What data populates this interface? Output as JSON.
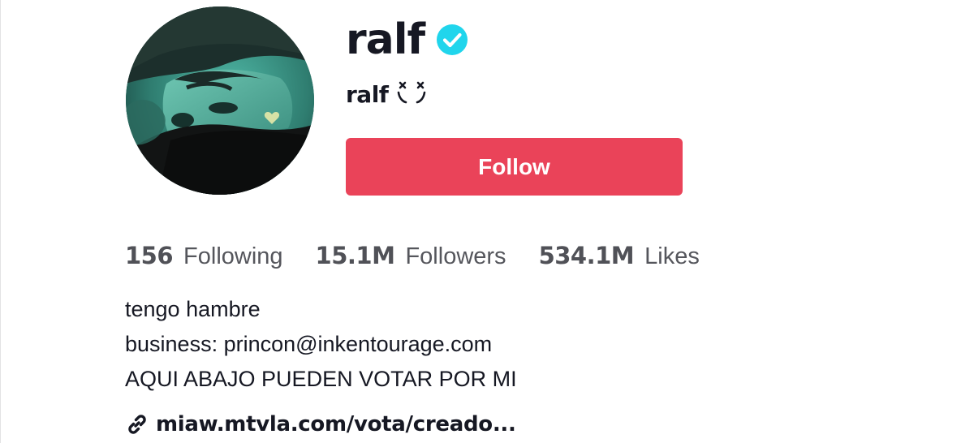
{
  "profile": {
    "username": "ralf",
    "verified_icon": "verified-check-icon",
    "nickname": "ralf",
    "nickname_kaomoji": "˘◡˘",
    "avatar_icon": "profile-avatar-photo"
  },
  "actions": {
    "follow_label": "Follow"
  },
  "stats": {
    "following": {
      "value": "156",
      "label": "Following"
    },
    "followers": {
      "value": "15.1M",
      "label": "Followers"
    },
    "likes": {
      "value": "534.1M",
      "label": "Likes"
    }
  },
  "bio": {
    "lines": [
      "tengo hambre",
      "business: princon@inkentourage.com",
      "AQUI ABAJO PUEDEN VOTAR POR MI"
    ]
  },
  "link": {
    "icon": "link-icon",
    "text": "miaw.mtvla.com/vota/creado..."
  },
  "colors": {
    "follow_button": "#ea4359",
    "verified_badge": "#20d5ec",
    "text_primary": "#161823",
    "text_secondary": "#55565c"
  }
}
